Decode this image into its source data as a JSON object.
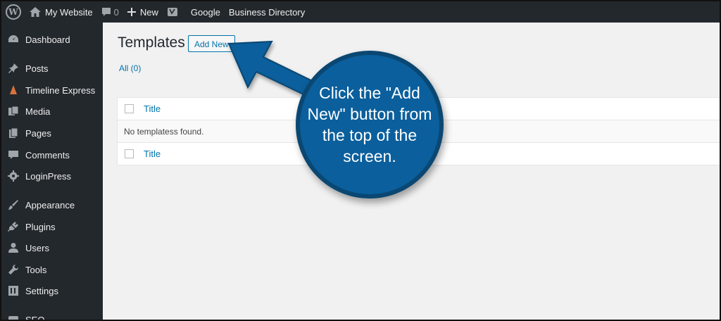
{
  "adminbar": {
    "site_name": "My Website",
    "comments_count": "0",
    "new_label": "New",
    "link_google": "Google",
    "link_directory": "Business Directory"
  },
  "sidebar": {
    "items": [
      {
        "label": "Dashboard",
        "icon": "dashboard-icon"
      },
      {
        "label": "Posts",
        "icon": "pin-icon"
      },
      {
        "label": "Timeline Express",
        "icon": "cone-icon"
      },
      {
        "label": "Media",
        "icon": "media-icon"
      },
      {
        "label": "Pages",
        "icon": "pages-icon"
      },
      {
        "label": "Comments",
        "icon": "comment-icon"
      },
      {
        "label": "LoginPress",
        "icon": "gear-icon"
      },
      {
        "label": "Appearance",
        "icon": "brush-icon"
      },
      {
        "label": "Plugins",
        "icon": "plug-icon"
      },
      {
        "label": "Users",
        "icon": "user-icon"
      },
      {
        "label": "Tools",
        "icon": "wrench-icon"
      },
      {
        "label": "Settings",
        "icon": "settings-icon"
      },
      {
        "label": "SEO",
        "icon": "seo-icon"
      }
    ]
  },
  "main": {
    "title": "Templates",
    "add_new_label": "Add New",
    "filter_all": "All (0)",
    "table": {
      "header_title": "Title",
      "empty_message": "No templatess found.",
      "footer_title": "Title"
    }
  },
  "callout": {
    "text": "Click the \"Add New\" button from the top of the screen."
  },
  "colors": {
    "adminbar_bg": "#23282d",
    "link_blue": "#0073aa",
    "callout_blue": "#0a5f9c"
  }
}
